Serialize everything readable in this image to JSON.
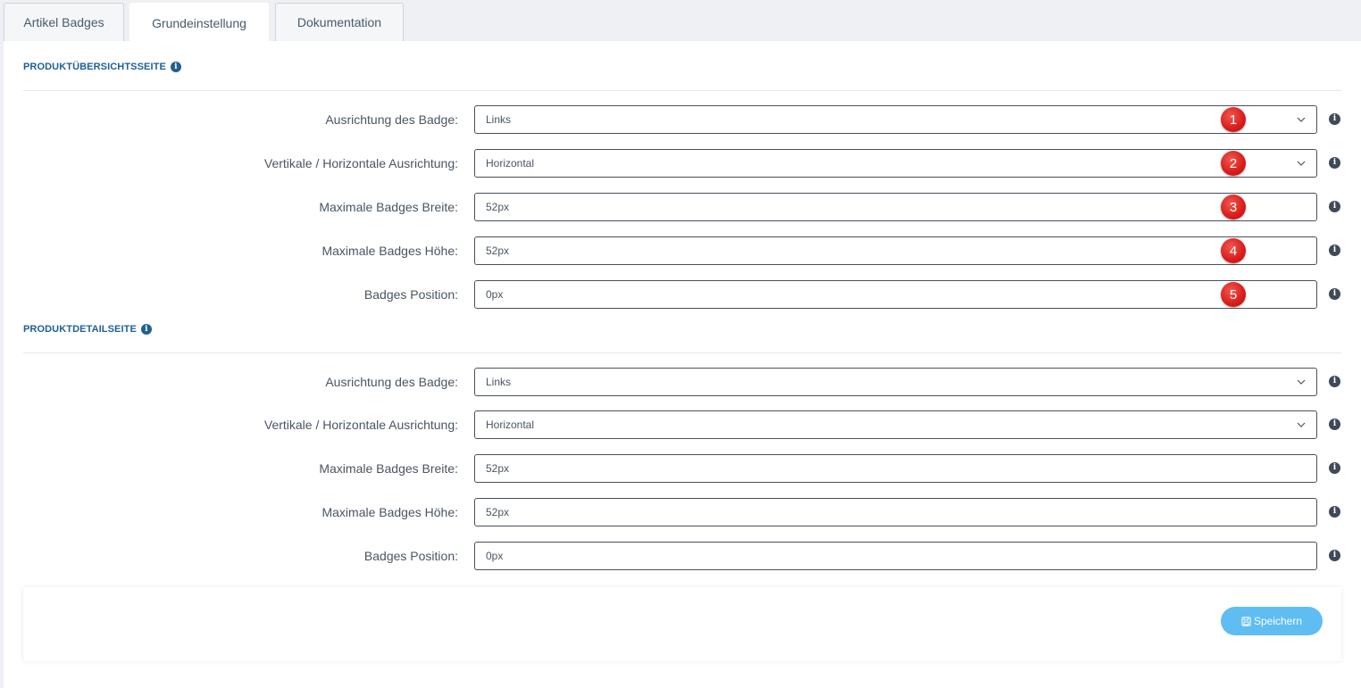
{
  "tabs": [
    {
      "label": "Artikel Badges",
      "active": false
    },
    {
      "label": "Grundeinstellung",
      "active": true
    },
    {
      "label": "Dokumentation",
      "active": false
    }
  ],
  "sections": [
    {
      "title": "PRODUKTÜBERSICHTSSEITE",
      "rows": [
        {
          "label": "Ausrichtung des Badge:",
          "value": "Links",
          "type": "select",
          "marker": "1"
        },
        {
          "label": "Vertikale / Horizontale Ausrichtung:",
          "value": "Horizontal",
          "type": "select",
          "marker": "2"
        },
        {
          "label": "Maximale Badges Breite:",
          "value": "52px",
          "type": "input",
          "marker": "3"
        },
        {
          "label": "Maximale Badges Höhe:",
          "value": "52px",
          "type": "input",
          "marker": "4"
        },
        {
          "label": "Badges Position:",
          "value": "0px",
          "type": "input",
          "marker": "5"
        }
      ]
    },
    {
      "title": "PRODUKTDETAILSEITE",
      "rows": [
        {
          "label": "Ausrichtung des Badge:",
          "value": "Links",
          "type": "select"
        },
        {
          "label": "Vertikale / Horizontale Ausrichtung:",
          "value": "Horizontal",
          "type": "select"
        },
        {
          "label": "Maximale Badges Breite:",
          "value": "52px",
          "type": "input"
        },
        {
          "label": "Maximale Badges Höhe:",
          "value": "52px",
          "type": "input"
        },
        {
          "label": "Badges Position:",
          "value": "0px",
          "type": "input"
        }
      ]
    }
  ],
  "save_button": {
    "label": "Speichern",
    "icon": "save-icon"
  },
  "colors": {
    "accent": "#1f5f95",
    "save_button": "#5fbdf2",
    "marker": "#d91b1b"
  }
}
